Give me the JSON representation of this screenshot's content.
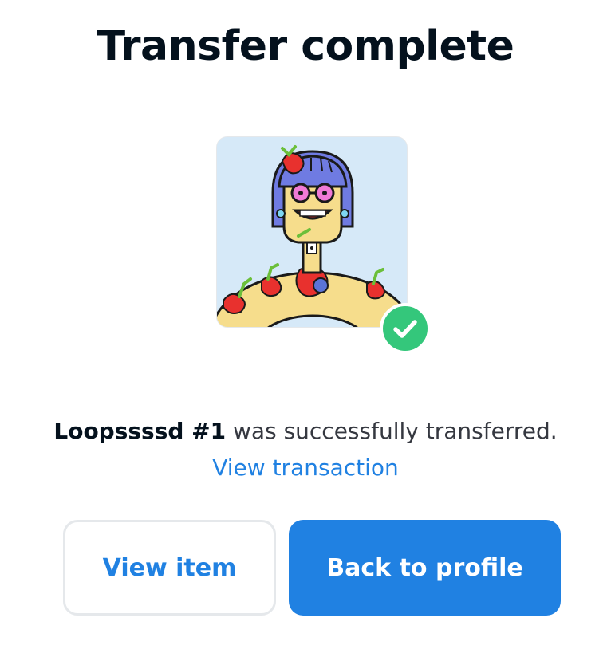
{
  "dialog": {
    "title": "Transfer complete",
    "item_name": "Loopssssd #1",
    "message_suffix": " was successfully transferred.",
    "view_transaction_label": "View transaction",
    "view_item_label": "View item",
    "back_to_profile_label": "Back to profile",
    "status_icon": "check-icon"
  },
  "colors": {
    "accent": "#2081e2",
    "success": "#34c77b",
    "title_text": "#04111d",
    "body_text": "#353840"
  }
}
